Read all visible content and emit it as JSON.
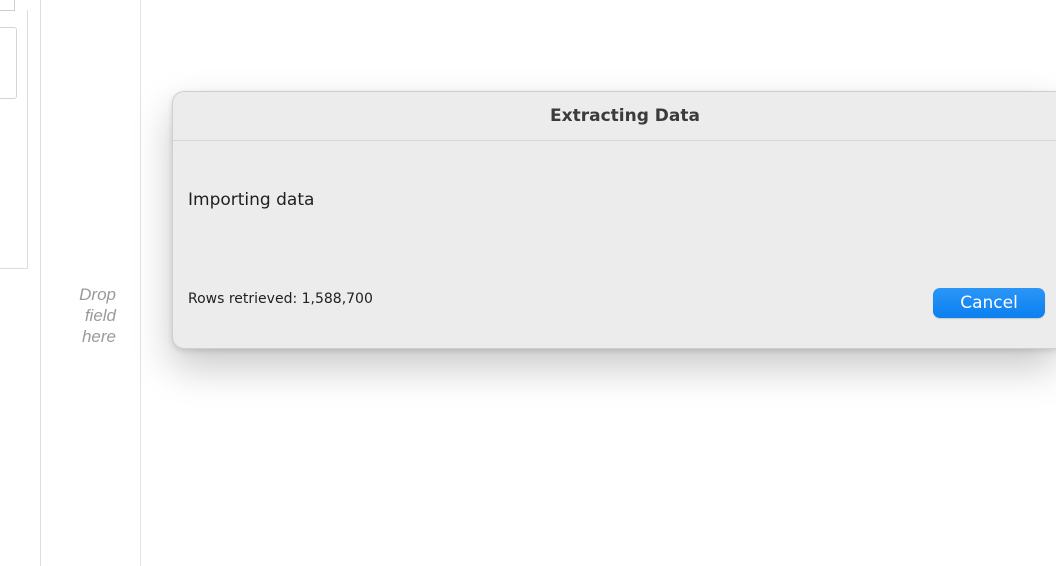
{
  "workspace": {
    "drop_field_label": "Drop\nfield\nhere"
  },
  "dialog": {
    "title": "Extracting Data",
    "message": "Importing data",
    "status": "Rows retrieved: 1,588,700",
    "cancel_label": "Cancel"
  },
  "colors": {
    "dialog_background": "#ececec",
    "accent_button": "#1a8cf5",
    "placeholder_text": "#9a9a9a"
  }
}
